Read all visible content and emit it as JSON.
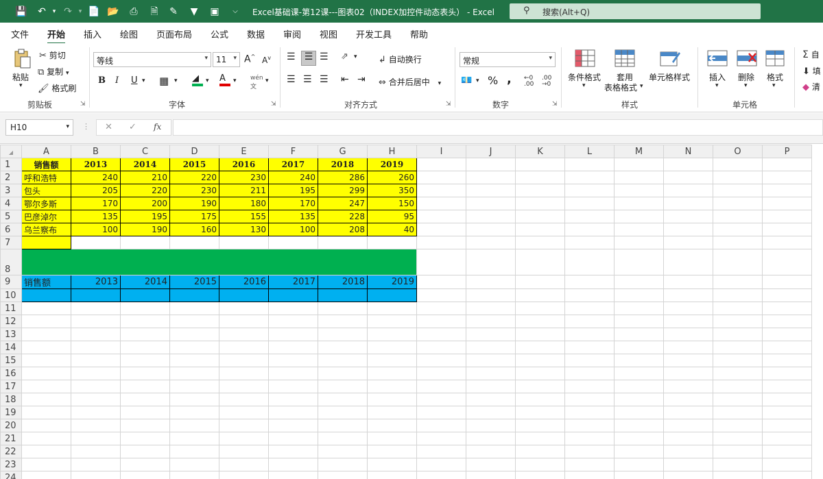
{
  "window": {
    "title": "Excel基础课-第12课---图表02（INDEX加控件动态表头）  -  Excel",
    "search_placeholder": "搜索(Alt+Q)"
  },
  "menu_tabs": [
    "文件",
    "开始",
    "插入",
    "绘图",
    "页面布局",
    "公式",
    "数据",
    "审阅",
    "视图",
    "开发工具",
    "帮助"
  ],
  "active_tab": "开始",
  "ribbon": {
    "clipboard": {
      "paste": "粘贴",
      "cut": "剪切",
      "copy": "复制",
      "format_painter": "格式刷",
      "label": "剪贴板"
    },
    "font": {
      "name": "等线",
      "size": "11",
      "grow": "A",
      "shrink": "A",
      "bold": "B",
      "italic": "I",
      "underline": "U",
      "label": "字体"
    },
    "alignment": {
      "wrap": "自动换行",
      "merge": "合并后居中",
      "label": "对齐方式"
    },
    "number": {
      "format": "常规",
      "percent": "%",
      "comma": ",",
      "label": "数字"
    },
    "styles": {
      "conditional": "条件格式",
      "table_line1": "套用",
      "table_line2": "表格格式",
      "cell_styles": "单元格样式",
      "label": "样式"
    },
    "cells": {
      "insert": "插入",
      "delete": "删除",
      "format": "格式",
      "label": "单元格"
    },
    "editing": {
      "autosum": "自",
      "fill": "填",
      "clear": "清"
    }
  },
  "formula_bar": {
    "name_box": "H10",
    "formula": "",
    "fx": "fx"
  },
  "columns": [
    "A",
    "B",
    "C",
    "D",
    "E",
    "F",
    "G",
    "H",
    "I",
    "J",
    "K",
    "L",
    "M",
    "N",
    "O",
    "P"
  ],
  "row_numbers": [
    "1",
    "2",
    "3",
    "4",
    "5",
    "6",
    "7",
    "8",
    "9",
    "10",
    "11",
    "12",
    "13",
    "14",
    "15",
    "16",
    "17",
    "18",
    "19",
    "20",
    "21",
    "22",
    "23",
    "24"
  ],
  "table": {
    "header": [
      "销售额",
      "2013",
      "2014",
      "2015",
      "2016",
      "2017",
      "2018",
      "2019"
    ],
    "rows": [
      [
        "呼和浩特",
        "240",
        "210",
        "220",
        "230",
        "240",
        "286",
        "260"
      ],
      [
        "包头",
        "205",
        "220",
        "230",
        "211",
        "195",
        "299",
        "350"
      ],
      [
        "鄂尔多斯",
        "170",
        "200",
        "190",
        "180",
        "170",
        "247",
        "150"
      ],
      [
        "巴彦淖尔",
        "135",
        "195",
        "175",
        "155",
        "135",
        "228",
        "95"
      ],
      [
        "乌兰察布",
        "100",
        "190",
        "160",
        "130",
        "100",
        "208",
        "40"
      ]
    ]
  },
  "dynamic_header": [
    "销售额",
    "2013",
    "2014",
    "2015",
    "2016",
    "2017",
    "2018",
    "2019"
  ],
  "colors": {
    "excel_green": "#217346",
    "yellow": "#ffff00",
    "green_band": "#00b050",
    "blue_band": "#00b0f0"
  }
}
